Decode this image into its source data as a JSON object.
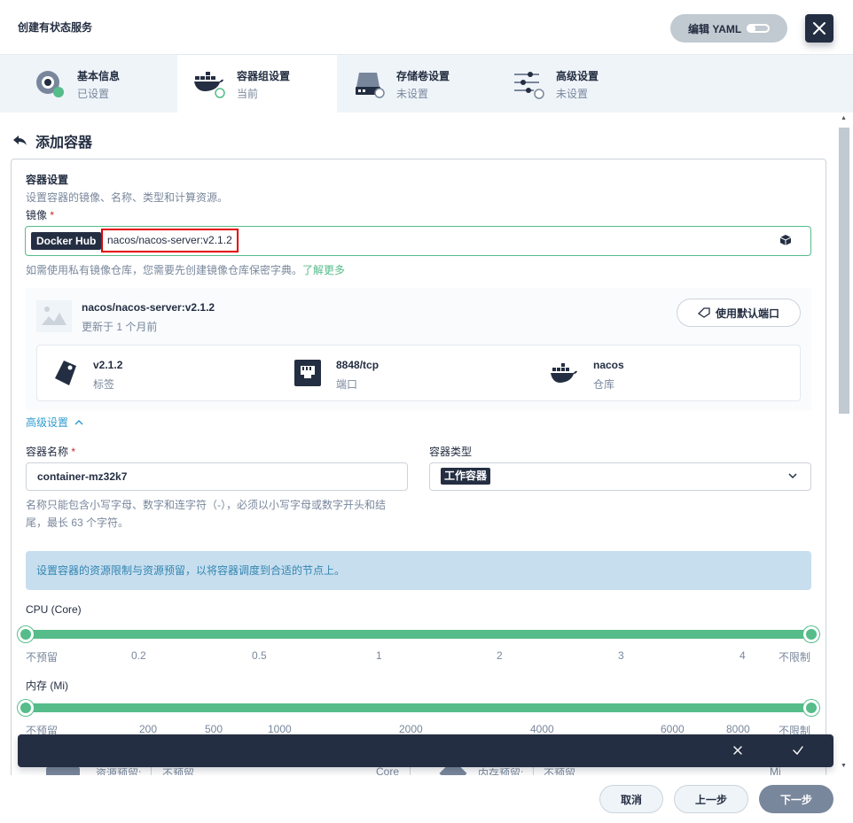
{
  "header": {
    "title": "创建有状态服务",
    "yaml_label": "编辑 YAML"
  },
  "tabs": [
    {
      "title": "基本信息",
      "status": "已设置",
      "icon": "basic-info-icon"
    },
    {
      "title": "容器组设置",
      "status": "当前",
      "icon": "docker-icon"
    },
    {
      "title": "存储卷设置",
      "status": "未设置",
      "icon": "storage-icon"
    },
    {
      "title": "高级设置",
      "status": "未设置",
      "icon": "sliders-icon"
    }
  ],
  "page": {
    "back_title": "添加容器"
  },
  "container_settings": {
    "title": "容器设置",
    "description": "设置容器的镜像、名称、类型和计算资源。",
    "image_label": "镜像",
    "required_mark": "*",
    "registry": "Docker Hub",
    "image_value": "nacos/nacos-server:v2.1.2",
    "private_hint": "如需使用私有镜像仓库，您需要先创建镜像仓库保密字典。",
    "learn_more": "了解更多"
  },
  "image_info": {
    "name": "nacos/nacos-server:v2.1.2",
    "updated": "更新于 1 个月前",
    "default_port_button": "使用默认端口",
    "stats": [
      {
        "value": "v2.1.2",
        "label": "标签"
      },
      {
        "value": "8848/tcp",
        "label": "端口"
      },
      {
        "value": "nacos",
        "label": "仓库"
      }
    ]
  },
  "advanced_toggle": "高级设置",
  "container_name": {
    "label": "容器名称",
    "value": "container-mz32k7",
    "hint": "名称只能包含小写字母、数字和连字符（-），必须以小写字母或数字开头和结尾，最长 63 个字符。"
  },
  "container_type": {
    "label": "容器类型",
    "value": "工作容器"
  },
  "resource_banner": "设置容器的资源限制与资源预留，以将容器调度到合适的节点上。",
  "cpu": {
    "label": "CPU (Core)",
    "ticks": [
      "不预留",
      "0.2",
      "0.5",
      "1",
      "2",
      "3",
      "4",
      "不限制"
    ],
    "min_position": 0,
    "max_position": 1
  },
  "memory": {
    "label": "内存 (Mi)",
    "ticks": [
      "不预留",
      "200",
      "500",
      "1000",
      "2000",
      "4000",
      "6000",
      "8000",
      "不限制"
    ],
    "min_position": 0,
    "max_position": 1
  },
  "under_row": {
    "cpu_reserve_label": "资源预留:",
    "cpu_reserve_value": "不预留",
    "cpu_unit": "Core",
    "mem_reserve_label": "内存预留:",
    "mem_reserve_value": "不预留",
    "mem_unit": "Mi"
  },
  "footer": {
    "cancel": "取消",
    "prev": "上一步",
    "next": "下一步"
  },
  "colors": {
    "primary_dark": "#242e42",
    "green": "#55bc8a",
    "link": "#329dce",
    "banner": "#c7deef",
    "tab_bg": "#eff4f9"
  }
}
